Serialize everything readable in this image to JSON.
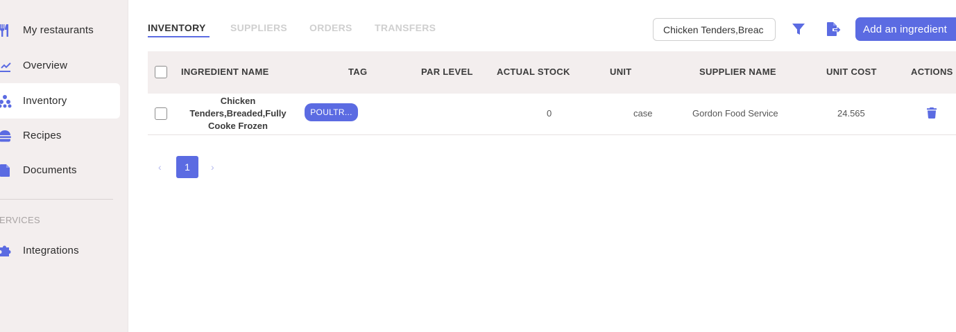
{
  "sidebar": {
    "items": [
      {
        "label": "My restaurants",
        "icon": "fork-knife-icon"
      },
      {
        "label": "Overview",
        "icon": "line-chart-icon"
      },
      {
        "label": "Inventory",
        "icon": "boxes-stack-icon"
      },
      {
        "label": "Recipes",
        "icon": "burger-icon"
      },
      {
        "label": "Documents",
        "icon": "document-icon"
      }
    ],
    "section_label": "ERVICES",
    "integrations": {
      "label": "Integrations",
      "icon": "puzzle-icon"
    }
  },
  "tabs": [
    {
      "label": "INVENTORY",
      "active": true
    },
    {
      "label": "SUPPLIERS",
      "active": false
    },
    {
      "label": "ORDERS",
      "active": false
    },
    {
      "label": "TRANSFERS",
      "active": false
    }
  ],
  "toolbar": {
    "search_value": "Chicken Tenders,Breac",
    "filter_icon": "filter-icon",
    "export_icon": "export-file-icon",
    "add_label": "Add an ingredient"
  },
  "table": {
    "headers": {
      "ingredient_name": "INGREDIENT NAME",
      "tag": "TAG",
      "par_level": "PAR LEVEL",
      "actual_stock": "ACTUAL STOCK",
      "unit": "UNIT",
      "supplier_name": "SUPPLIER NAME",
      "unit_cost": "UNIT COST",
      "actions": "ACTIONS"
    },
    "rows": [
      {
        "name_line1": "Chicken",
        "name_line2": "Tenders,Breaded,Fully",
        "name_line3": "Cooke Frozen",
        "tag": "POULTR...",
        "par_level": "",
        "actual_stock": "0",
        "unit": "case",
        "supplier": "Gordon Food Service",
        "unit_cost": "24.565",
        "action_icon": "trash-icon"
      }
    ]
  },
  "pagination": {
    "current_page": "1",
    "prev": "‹",
    "next": "›"
  },
  "colors": {
    "accent": "#5b6be2",
    "sidebar_bg": "#f3eeee"
  }
}
